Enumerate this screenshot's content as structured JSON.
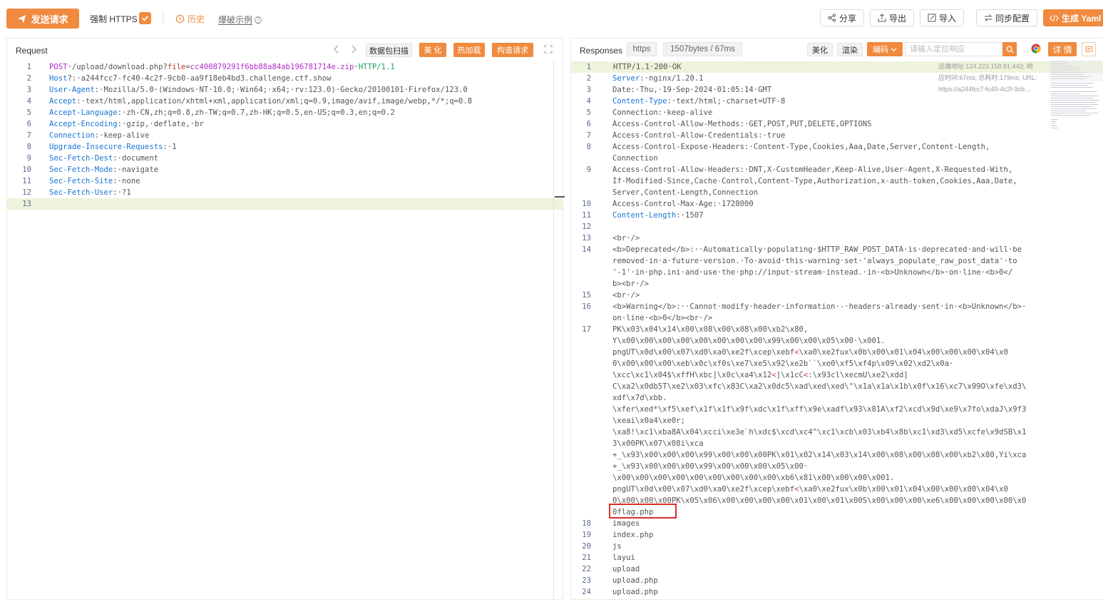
{
  "toolbar": {
    "send_label": "发送请求",
    "force_https_label": "强制 HTTPS",
    "force_https_checked": true,
    "history_label": "历史",
    "example_label": "爆破示例",
    "share_label": "分享",
    "export_label": "导出",
    "import_label": "导入",
    "sync_label": "同步配置",
    "yaml_label": "生成 Yaml",
    "accent_color": "#f08a3e"
  },
  "request": {
    "title": "Request",
    "scan_label": "数据包扫描",
    "beautify_label": "美 化",
    "hotload_label": "热加载",
    "build_label": "构造请求",
    "lines": [
      {
        "n": "1",
        "parts": [
          [
            "m",
            "POST"
          ],
          [
            "u",
            "·/upload/download.php?"
          ],
          [
            "v",
            "file"
          ],
          [
            "u",
            "="
          ],
          [
            "m",
            "cc400879291f6bb88a84ab196781714e.zip"
          ],
          [
            "u",
            "·"
          ],
          [
            "p",
            "HTTP/1.1"
          ]
        ]
      },
      {
        "n": "2",
        "parts": [
          [
            "k",
            "Host"
          ],
          [
            "u",
            "?"
          ],
          [
            "u",
            ":·a244fcc7-fc40-4c2f-9cb0-aa9f18eb4bd3.challenge.ctf.show"
          ]
        ]
      },
      {
        "n": "3",
        "parts": [
          [
            "k",
            "User-Agent"
          ],
          [
            "u",
            ":·Mozilla/5.0·(Windows·NT·10.0;·Win64;·x64;·rv:123.0)·Gecko/20100101·Firefox/123.0"
          ]
        ]
      },
      {
        "n": "4",
        "parts": [
          [
            "k",
            "Accept"
          ],
          [
            "u",
            ":·text/html,application/xhtml+xml,application/xml;q=0.9,image/avif,image/webp,*/*;q=0.8"
          ]
        ]
      },
      {
        "n": "5",
        "parts": [
          [
            "k",
            "Accept-Language"
          ],
          [
            "u",
            ":·zh-CN,zh;q=0.8,zh-TW;q=0.7,zh-HK;q=0.5,en-US;q=0.3,en;q=0.2"
          ]
        ]
      },
      {
        "n": "6",
        "parts": [
          [
            "k",
            "Accept-Encoding"
          ],
          [
            "u",
            ":·gzip,·deflate,·br"
          ]
        ]
      },
      {
        "n": "7",
        "parts": [
          [
            "k",
            "Connection"
          ],
          [
            "u",
            ":·keep-alive"
          ]
        ]
      },
      {
        "n": "8",
        "parts": [
          [
            "k",
            "Upgrade-Insecure-Requests"
          ],
          [
            "u",
            ":·1"
          ]
        ]
      },
      {
        "n": "9",
        "parts": [
          [
            "k",
            "Sec-Fetch-Dest"
          ],
          [
            "u",
            ":·document"
          ]
        ]
      },
      {
        "n": "10",
        "parts": [
          [
            "k",
            "Sec-Fetch-Mode"
          ],
          [
            "u",
            ":·navigate"
          ]
        ]
      },
      {
        "n": "11",
        "parts": [
          [
            "k",
            "Sec-Fetch-Site"
          ],
          [
            "u",
            ":·none"
          ]
        ]
      },
      {
        "n": "12",
        "parts": [
          [
            "k",
            "Sec-Fetch-User"
          ],
          [
            "u",
            ":·?1"
          ]
        ]
      },
      {
        "n": "13",
        "parts": [],
        "active": true
      }
    ]
  },
  "response": {
    "title": "Responses",
    "protocol": "https",
    "size_time": "1507bytes / 67ms",
    "beautify_label": "美化",
    "render_label": "渲染",
    "encoding_label": "编码",
    "search_placeholder": "请输入定位响应",
    "detail_label": "详 情",
    "remote_addr": "远端地址:124.223.158.81:443; 响",
    "timing": "应时间:67ms; 总耗时:179ms; URL:",
    "url": "https://a244fcc7-fc40-4c2f-9cb...",
    "highlighted_text": "0flag.php",
    "lines": [
      {
        "n": "1",
        "active": true,
        "parts": [
          [
            "u",
            "HTTP/1.1·200·OK"
          ]
        ]
      },
      {
        "n": "2",
        "parts": [
          [
            "k",
            "Server"
          ],
          [
            "u",
            ":·nginx/1.20.1"
          ]
        ]
      },
      {
        "n": "3",
        "parts": [
          [
            "u",
            "Date:·Thu,·19·Sep·2024·01:05:14·GMT"
          ]
        ]
      },
      {
        "n": "4",
        "parts": [
          [
            "k",
            "Content-Type"
          ],
          [
            "u",
            ":·text/html;·charset=UTF-8"
          ]
        ]
      },
      {
        "n": "5",
        "parts": [
          [
            "u",
            "Connection:·keep-alive"
          ]
        ]
      },
      {
        "n": "6",
        "parts": [
          [
            "u",
            "Access-Control-Allow-Methods:·GET,POST,PUT,DELETE,OPTIONS"
          ]
        ]
      },
      {
        "n": "7",
        "parts": [
          [
            "u",
            "Access-Control-Allow-Credentials:·true"
          ]
        ]
      },
      {
        "n": "8",
        "parts": [
          [
            "u",
            "Access-Control-Expose-Headers:·Content-Type,Cookies,Aaa,Date,Server,Content-Length,"
          ]
        ]
      },
      {
        "n": "",
        "parts": [
          [
            "u",
            "Connection"
          ]
        ]
      },
      {
        "n": "9",
        "parts": [
          [
            "u",
            "Access-Control-Allow-Headers:·DNT,X-CustomHeader,Keep-Alive,User-Agent,X-Requested-With,"
          ]
        ]
      },
      {
        "n": "",
        "parts": [
          [
            "u",
            "If-Modified-Since,Cache-Control,Content-Type,Authorization,x-auth-token,Cookies,Aaa,Date,"
          ]
        ]
      },
      {
        "n": "",
        "parts": [
          [
            "u",
            "Server,Content-Length,Connection"
          ]
        ]
      },
      {
        "n": "10",
        "parts": [
          [
            "u",
            "Access-Control-Max-Age:·1728000"
          ]
        ]
      },
      {
        "n": "11",
        "parts": [
          [
            "k",
            "Content-Length"
          ],
          [
            "u",
            ":·1507"
          ]
        ]
      },
      {
        "n": "12",
        "parts": []
      },
      {
        "n": "13",
        "parts": [
          [
            "u",
            "<br·/>"
          ]
        ]
      },
      {
        "n": "14",
        "parts": [
          [
            "u",
            "<b>Deprecated</b>:··Automatically·populating·$HTTP_RAW_POST_DATA·is·deprecated·and·will·be"
          ]
        ]
      },
      {
        "n": "",
        "parts": [
          [
            "u",
            "removed·in·a·future·version.·To·avoid·this·warning·set·'always_populate_raw_post_data'·to"
          ]
        ]
      },
      {
        "n": "",
        "parts": [
          [
            "u",
            "'-1'·in·php.ini·and·use·the·php://input·stream·instead.·in·<b>Unknown</b>·on·line·<b>0</"
          ]
        ]
      },
      {
        "n": "",
        "parts": [
          [
            "u",
            "b><br·/>"
          ]
        ]
      },
      {
        "n": "15",
        "parts": [
          [
            "u",
            "<br·/>"
          ]
        ]
      },
      {
        "n": "16",
        "parts": [
          [
            "u",
            "<b>Warning</b>:··Cannot·modify·header·information·-·headers·already·sent·in·<b>Unknown</b>·"
          ]
        ]
      },
      {
        "n": "",
        "parts": [
          [
            "u",
            "on·line·<b>0</b><br·/>"
          ]
        ]
      },
      {
        "n": "17",
        "parts": [
          [
            "u",
            "PK\\x03\\x04\\x14\\x00\\x08\\x00\\x08\\x00\\xb2\\x80,"
          ]
        ]
      },
      {
        "n": "",
        "parts": [
          [
            "u",
            "Y\\x00\\x00\\x00\\x00\\x00\\x00\\x00\\x00\\x99\\x00\\x00\\x05\\x00·\\x001."
          ]
        ]
      },
      {
        "n": "",
        "parts": [
          [
            "u",
            "pngUT\\x0d\\x00\\x07\\xd0\\xa0\\xe2f\\xcep\\xebf"
          ],
          [
            "v",
            "<"
          ],
          [
            "u",
            "\\xa0\\xe2fux\\x0b\\x00\\x01\\x04\\x00\\x00\\x00\\x04\\x0"
          ]
        ]
      },
      {
        "n": "",
        "parts": [
          [
            "u",
            "0\\x00\\x00\\x00\\xeb\\x0c\\xf0s\\xe7\\xe5\\x92\\xe2b``\\xe0\\xf5\\xf4p\\x09\\x02\\xd2\\x0a·"
          ]
        ]
      },
      {
        "n": "",
        "parts": [
          [
            "u",
            "\\xcc\\xc1\\x04$\\xffH\\xbc]\\x0c\\xa4\\x12"
          ],
          [
            "v",
            "<"
          ],
          [
            "u",
            "]\\x1cC"
          ],
          [
            "v",
            "<"
          ],
          [
            "u",
            ":\\x93cl\\xecmU\\xe2\\xdd]"
          ]
        ]
      },
      {
        "n": "",
        "parts": [
          [
            "u",
            "C\\xa2\\x0db5T\\xe2\\x03\\xfc\\x83C\\xa2\\x0dc5\\xad\\xed\\xed\\\"\\x1a\\x1a\\x1b\\x0f\\x16\\xc7\\x99O\\xfe\\xd3\\"
          ]
        ]
      },
      {
        "n": "",
        "parts": [
          [
            "u",
            "xdf\\x7d\\xbb."
          ]
        ]
      },
      {
        "n": "",
        "parts": [
          [
            "u",
            "\\xfer\\xed*\\xf5\\xef\\x1f\\x1f\\x9f\\xdc\\x1f\\xff\\x9e\\xadf\\x93\\x81A\\xf2\\xcd\\x9d\\xe9\\x7fo\\xdaJ\\x9f3"
          ]
        ]
      },
      {
        "n": "",
        "parts": [
          [
            "u",
            "\\xeai\\x0a4\\xe0r;"
          ]
        ]
      },
      {
        "n": "",
        "parts": [
          [
            "u",
            "\\xa8!\\xc1\\xba8A\\x04\\xcci\\xe3e`h\\xdc$\\xcd\\xc4^\\xc1\\xcb\\x03\\xb4\\x8b\\xc1\\xd3\\xd5\\xcfe\\x9dSB\\x1"
          ]
        ]
      },
      {
        "n": "",
        "parts": [
          [
            "u",
            "3\\x00PK\\x07\\x08i\\xca"
          ]
        ]
      },
      {
        "n": "",
        "parts": [
          [
            "u",
            "+_\\x93\\x00\\x00\\x00\\x99\\x00\\x00\\x00PK\\x01\\x02\\x14\\x03\\x14\\x00\\x08\\x00\\x08\\x00\\xb2\\x80,Yi\\xca"
          ]
        ]
      },
      {
        "n": "",
        "parts": [
          [
            "u",
            "+_\\x93\\x00\\x00\\x00\\x99\\x00\\x00\\x00\\x05\\x00·"
          ]
        ]
      },
      {
        "n": "",
        "parts": [
          [
            "u",
            "\\x00\\x00\\x00\\x00\\x00\\x00\\x00\\x00\\x00\\xb6\\x81\\x00\\x00\\x00\\x001."
          ]
        ]
      },
      {
        "n": "",
        "parts": [
          [
            "u",
            "pngUT\\x0d\\x00\\x07\\xd0\\xa0\\xe2f\\xcep\\xebf"
          ],
          [
            "v",
            "<"
          ],
          [
            "u",
            "\\xa0\\xe2fux\\x0b\\x00\\x01\\x04\\x00\\x00\\x00\\x04\\x0"
          ]
        ]
      },
      {
        "n": "",
        "parts": [
          [
            "u",
            "0\\x00\\x00\\x00PK\\x05\\x06\\x00\\x00\\x00\\x00\\x01\\x00\\x01\\x00S\\x00\\x00\\x00\\xe6\\x00\\x00\\x00\\x00\\x0"
          ]
        ]
      },
      {
        "n": "",
        "parts": [
          [
            "u",
            "0flag.php"
          ]
        ]
      },
      {
        "n": "18",
        "parts": [
          [
            "u",
            "images"
          ]
        ]
      },
      {
        "n": "19",
        "parts": [
          [
            "u",
            "index.php"
          ]
        ]
      },
      {
        "n": "20",
        "parts": [
          [
            "u",
            "js"
          ]
        ]
      },
      {
        "n": "21",
        "parts": [
          [
            "u",
            "layui"
          ]
        ]
      },
      {
        "n": "22",
        "parts": [
          [
            "u",
            "upload"
          ]
        ]
      },
      {
        "n": "23",
        "parts": [
          [
            "u",
            "upload.php"
          ]
        ]
      },
      {
        "n": "24",
        "parts": [
          [
            "u",
            "upload.php"
          ]
        ]
      }
    ]
  }
}
